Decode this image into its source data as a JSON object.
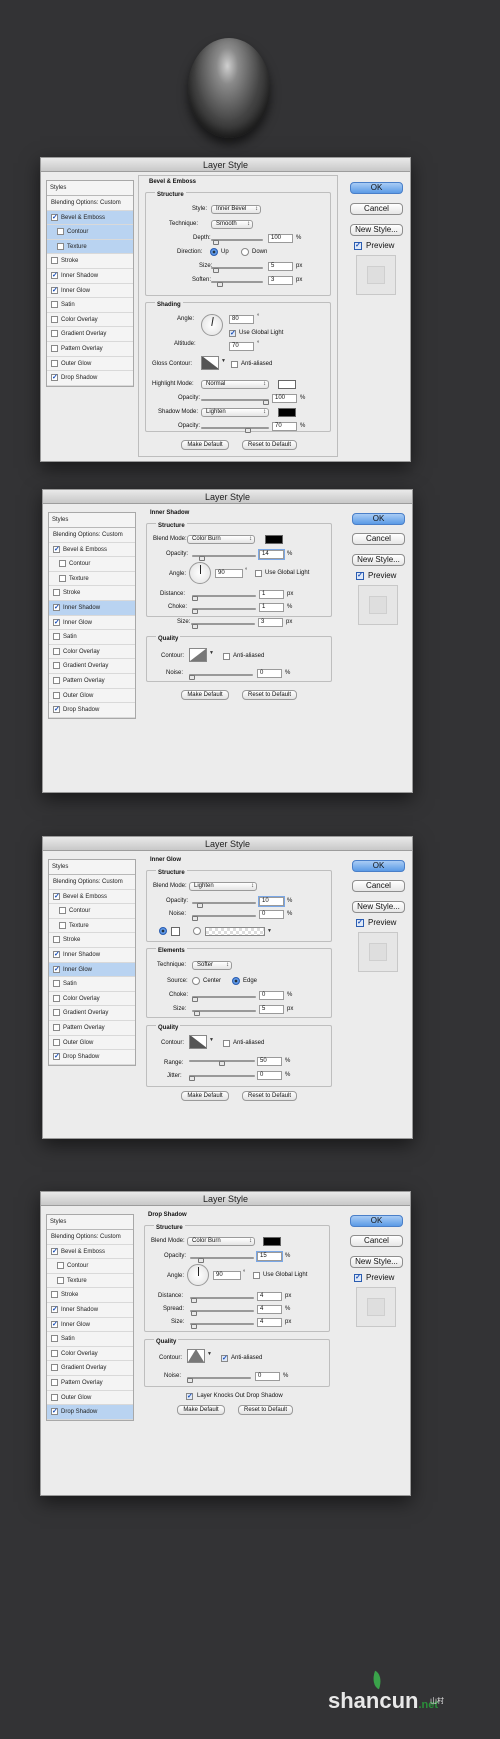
{
  "styles_list": {
    "header": "Styles",
    "blending": "Blending Options: Custom",
    "items": [
      "Bevel & Emboss",
      "Contour",
      "Texture",
      "Stroke",
      "Inner Shadow",
      "Inner Glow",
      "Satin",
      "Color Overlay",
      "Gradient Overlay",
      "Pattern Overlay",
      "Outer Glow",
      "Drop Shadow"
    ]
  },
  "buttons": {
    "ok": "OK",
    "cancel": "Cancel",
    "new_style": "New Style...",
    "preview": "Preview",
    "make_default": "Make Default",
    "reset_default": "Reset to Default"
  },
  "dialog_title": "Layer Style",
  "bevel": {
    "title": "Bevel & Emboss",
    "structure": "Structure",
    "style_label": "Style:",
    "style_value": "Inner Bevel",
    "technique_label": "Technique:",
    "technique_value": "Smooth",
    "depth_label": "Depth:",
    "depth_value": "100",
    "depth_unit": "%",
    "direction_label": "Direction:",
    "up": "Up",
    "down": "Down",
    "size_label": "Size:",
    "size_value": "5",
    "size_unit": "px",
    "soften_label": "Soften:",
    "soften_value": "3",
    "soften_unit": "px",
    "shading": "Shading",
    "angle_label": "Angle:",
    "angle_value": "80",
    "deg": "°",
    "use_global": "Use Global Light",
    "altitude_label": "Altitude:",
    "altitude_value": "70",
    "gloss_label": "Gloss Contour:",
    "antialiased": "Anti-aliased",
    "highlight_label": "Highlight Mode:",
    "highlight_value": "Normal",
    "opacity_label": "Opacity:",
    "hl_opacity": "100",
    "pct": "%",
    "shadow_label": "Shadow Mode:",
    "shadow_value": "Lighten",
    "sh_opacity": "70"
  },
  "inner_shadow": {
    "title": "Inner Shadow",
    "structure": "Structure",
    "blend_label": "Blend Mode:",
    "blend_value": "Color Burn",
    "opacity_label": "Opacity:",
    "opacity_value": "14",
    "pct": "%",
    "angle_label": "Angle:",
    "angle_value": "90",
    "deg": "°",
    "use_global": "Use Global Light",
    "distance_label": "Distance:",
    "distance_value": "1",
    "choke_label": "Choke:",
    "choke_value": "1",
    "size_label": "Size:",
    "size_value": "3",
    "px": "px",
    "quality": "Quality",
    "contour_label": "Contour:",
    "antialiased": "Anti-aliased",
    "noise_label": "Noise:",
    "noise_value": "0"
  },
  "inner_glow": {
    "title": "Inner Glow",
    "structure": "Structure",
    "blend_label": "Blend Mode:",
    "blend_value": "Lighten",
    "opacity_label": "Opacity:",
    "opacity_value": "10",
    "pct": "%",
    "noise_label": "Noise:",
    "noise_value": "0",
    "elements": "Elements",
    "technique_label": "Technique:",
    "technique_value": "Softer",
    "source_label": "Source:",
    "center": "Center",
    "edge": "Edge",
    "choke_label": "Choke:",
    "choke_value": "0",
    "size_label": "Size:",
    "size_value": "5",
    "px": "px",
    "quality": "Quality",
    "contour_label": "Contour:",
    "antialiased": "Anti-aliased",
    "range_label": "Range:",
    "range_value": "50",
    "jitter_label": "Jitter:",
    "jitter_value": "0"
  },
  "drop_shadow": {
    "title": "Drop Shadow",
    "structure": "Structure",
    "blend_label": "Blend Mode:",
    "blend_value": "Color Burn",
    "opacity_label": "Opacity:",
    "opacity_value": "15",
    "pct": "%",
    "angle_label": "Angle:",
    "angle_value": "90",
    "deg": "°",
    "use_global": "Use Global Light",
    "distance_label": "Distance:",
    "distance_value": "4",
    "spread_label": "Spread:",
    "spread_value": "4",
    "size_label": "Size:",
    "size_value": "4",
    "px": "px",
    "quality": "Quality",
    "contour_label": "Contour:",
    "antialiased": "Anti-aliased",
    "noise_label": "Noise:",
    "noise_value": "0",
    "knocks": "Layer Knocks Out Drop Shadow"
  },
  "watermark": {
    "brand": "shancun",
    "suffix": ".net",
    "cn": "山村"
  },
  "colors": {
    "background": "#333335",
    "accent": "#5b9be6",
    "selected_row": "#b9d3f1"
  }
}
